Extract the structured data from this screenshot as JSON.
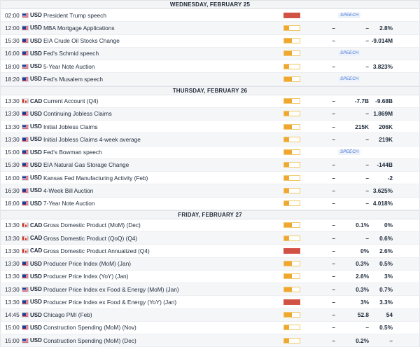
{
  "colors": {
    "impact_medium": "#f0a732",
    "impact_high": "#cf5244",
    "speech_text": "#3b6fd1"
  },
  "days": [
    {
      "label": "WEDNESDAY, FEBRUARY 25",
      "events": [
        {
          "time": "02:00",
          "country": "US",
          "currency": "USD",
          "event": "President Trump speech",
          "impact": "high",
          "impact_level": 1.0,
          "actual": "",
          "forecast": "",
          "previous": "",
          "speech": "SPEECH"
        },
        {
          "time": "12:00",
          "country": "US",
          "currency": "USD",
          "event": "MBA Mortgage Applications",
          "impact": "low",
          "impact_level": 0.33,
          "actual": "–",
          "forecast": "–",
          "previous": "2.8%",
          "speech": ""
        },
        {
          "time": "15:30",
          "country": "US",
          "currency": "USD",
          "event": "EIA Crude Oil Stocks Change",
          "impact": "medium",
          "impact_level": 0.5,
          "actual": "–",
          "forecast": "–",
          "previous": "-9.014M",
          "speech": ""
        },
        {
          "time": "16:00",
          "country": "US",
          "currency": "USD",
          "event": "Fed's Schmid speech",
          "impact": "medium",
          "impact_level": 0.5,
          "actual": "",
          "forecast": "",
          "previous": "",
          "speech": "SPEECH"
        },
        {
          "time": "18:00",
          "country": "US",
          "currency": "USD",
          "event": "5-Year Note Auction",
          "impact": "low",
          "impact_level": 0.33,
          "actual": "–",
          "forecast": "–",
          "previous": "3.823%",
          "speech": ""
        },
        {
          "time": "18:20",
          "country": "US",
          "currency": "USD",
          "event": "Fed's Musalem speech",
          "impact": "medium",
          "impact_level": 0.5,
          "actual": "",
          "forecast": "",
          "previous": "",
          "speech": "SPEECH"
        }
      ]
    },
    {
      "label": "THURSDAY, FEBRUARY 26",
      "events": [
        {
          "time": "13:30",
          "country": "CA",
          "currency": "CAD",
          "event": "Current Account (Q4)",
          "impact": "medium",
          "impact_level": 0.5,
          "actual": "–",
          "forecast": "-7.7B",
          "previous": "-9.68B",
          "speech": ""
        },
        {
          "time": "13:30",
          "country": "US",
          "currency": "USD",
          "event": "Continuing Jobless Claims",
          "impact": "low",
          "impact_level": 0.33,
          "actual": "–",
          "forecast": "–",
          "previous": "1.869M",
          "speech": ""
        },
        {
          "time": "13:30",
          "country": "US",
          "currency": "USD",
          "event": "Initial Jobless Claims",
          "impact": "medium",
          "impact_level": 0.5,
          "actual": "–",
          "forecast": "215K",
          "previous": "206K",
          "speech": ""
        },
        {
          "time": "13:30",
          "country": "US",
          "currency": "USD",
          "event": "Initial Jobless Claims 4-week average",
          "impact": "low",
          "impact_level": 0.33,
          "actual": "–",
          "forecast": "–",
          "previous": "219K",
          "speech": ""
        },
        {
          "time": "15:00",
          "country": "US",
          "currency": "USD",
          "event": "Fed's Bowman speech",
          "impact": "medium",
          "impact_level": 0.5,
          "actual": "",
          "forecast": "",
          "previous": "",
          "speech": "SPEECH"
        },
        {
          "time": "15:30",
          "country": "US",
          "currency": "USD",
          "event": "EIA Natural Gas Storage Change",
          "impact": "low",
          "impact_level": 0.33,
          "actual": "–",
          "forecast": "–",
          "previous": "-144B",
          "speech": ""
        },
        {
          "time": "16:00",
          "country": "US",
          "currency": "USD",
          "event": "Kansas Fed Manufacturing Activity (Feb)",
          "impact": "low",
          "impact_level": 0.33,
          "actual": "–",
          "forecast": "–",
          "previous": "-2",
          "speech": ""
        },
        {
          "time": "16:30",
          "country": "US",
          "currency": "USD",
          "event": "4-Week Bill Auction",
          "impact": "low",
          "impact_level": 0.33,
          "actual": "–",
          "forecast": "–",
          "previous": "3.625%",
          "speech": ""
        },
        {
          "time": "18:00",
          "country": "US",
          "currency": "USD",
          "event": "7-Year Note Auction",
          "impact": "low",
          "impact_level": 0.33,
          "actual": "–",
          "forecast": "–",
          "previous": "4.018%",
          "speech": ""
        }
      ]
    },
    {
      "label": "FRIDAY, FEBRUARY 27",
      "events": [
        {
          "time": "13:30",
          "country": "CA",
          "currency": "CAD",
          "event": "Gross Domestic Product (MoM) (Dec)",
          "impact": "medium",
          "impact_level": 0.5,
          "actual": "–",
          "forecast": "0.1%",
          "previous": "0%",
          "speech": ""
        },
        {
          "time": "13:30",
          "country": "CA",
          "currency": "CAD",
          "event": "Gross Domestic Product (QoQ) (Q4)",
          "impact": "low",
          "impact_level": 0.33,
          "actual": "–",
          "forecast": "–",
          "previous": "0.6%",
          "speech": ""
        },
        {
          "time": "13:30",
          "country": "CA",
          "currency": "CAD",
          "event": "Gross Domestic Product Annualized (Q4)",
          "impact": "high",
          "impact_level": 1.0,
          "actual": "–",
          "forecast": "0%",
          "previous": "2.6%",
          "speech": ""
        },
        {
          "time": "13:30",
          "country": "US",
          "currency": "USD",
          "event": "Producer Price Index (MoM) (Jan)",
          "impact": "medium",
          "impact_level": 0.5,
          "actual": "–",
          "forecast": "0.3%",
          "previous": "0.5%",
          "speech": ""
        },
        {
          "time": "13:30",
          "country": "US",
          "currency": "USD",
          "event": "Producer Price Index (YoY) (Jan)",
          "impact": "medium",
          "impact_level": 0.5,
          "actual": "–",
          "forecast": "2.6%",
          "previous": "3%",
          "speech": ""
        },
        {
          "time": "13:30",
          "country": "US",
          "currency": "USD",
          "event": "Producer Price Index ex Food & Energy (MoM) (Jan)",
          "impact": "medium",
          "impact_level": 0.5,
          "actual": "–",
          "forecast": "0.3%",
          "previous": "0.7%",
          "speech": ""
        },
        {
          "time": "13:30",
          "country": "US",
          "currency": "USD",
          "event": "Producer Price Index ex Food & Energy (YoY) (Jan)",
          "impact": "high",
          "impact_level": 1.0,
          "actual": "–",
          "forecast": "3%",
          "previous": "3.3%",
          "speech": ""
        },
        {
          "time": "14:45",
          "country": "US",
          "currency": "USD",
          "event": "Chicago PMI (Feb)",
          "impact": "medium",
          "impact_level": 0.5,
          "actual": "–",
          "forecast": "52.8",
          "previous": "54",
          "speech": ""
        },
        {
          "time": "15:00",
          "country": "US",
          "currency": "USD",
          "event": "Construction Spending (MoM) (Nov)",
          "impact": "low",
          "impact_level": 0.33,
          "actual": "–",
          "forecast": "–",
          "previous": "0.5%",
          "speech": ""
        },
        {
          "time": "15:00",
          "country": "US",
          "currency": "USD",
          "event": "Construction Spending (MoM) (Dec)",
          "impact": "low",
          "impact_level": 0.33,
          "actual": "–",
          "forecast": "0.2%",
          "previous": "–",
          "speech": ""
        }
      ]
    }
  ]
}
